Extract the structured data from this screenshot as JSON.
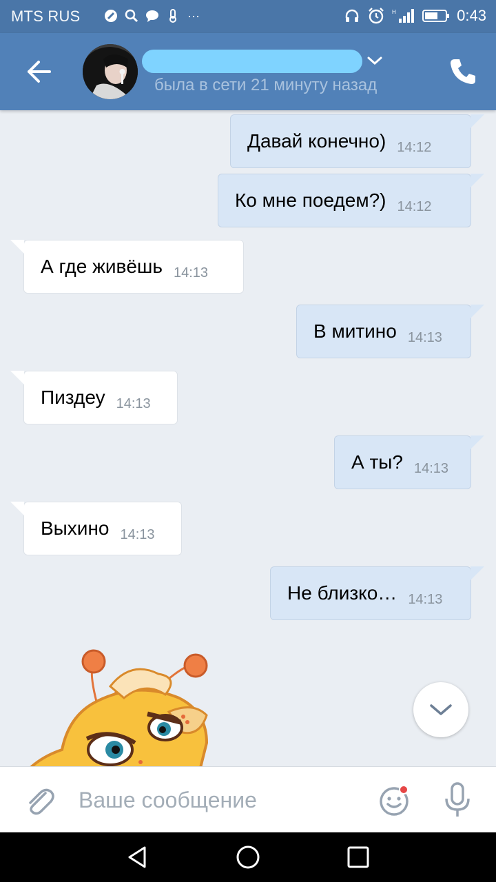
{
  "status_bar": {
    "carrier": "MTS RUS",
    "time": "0:43",
    "notification_icons": [
      "broom-icon",
      "search-icon",
      "chat-icon",
      "thermometer-icon",
      "more-icon"
    ],
    "more_glyph": "···"
  },
  "header": {
    "contact_name": "",
    "last_seen": "была в сети 21 минуту назад"
  },
  "messages": [
    {
      "direction": "out",
      "text": "Давай конечно)",
      "time": "14:12"
    },
    {
      "direction": "out",
      "text": "Ко мне поедем?)",
      "time": "14:12"
    },
    {
      "direction": "in",
      "text": "А где живёшь",
      "time": "14:13"
    },
    {
      "direction": "out",
      "text": "В митино",
      "time": "14:13"
    },
    {
      "direction": "in",
      "text": "Пиздеу",
      "time": "14:13"
    },
    {
      "direction": "out",
      "text": "А ты?",
      "time": "14:13"
    },
    {
      "direction": "in",
      "text": "Выхино",
      "time": "14:13"
    },
    {
      "direction": "out",
      "text": "Не близко…",
      "time": "14:13"
    }
  ],
  "input_bar": {
    "placeholder": "Ваше сообщение"
  },
  "colors": {
    "status_bar": "#4a76a8",
    "header": "#5181b8",
    "chat_bg": "#eaeef3",
    "bubble_out": "#d8e6f6",
    "bubble_in": "#ffffff",
    "name_redaction": "#7fd3ff",
    "emoji_badge": "#e64646"
  }
}
